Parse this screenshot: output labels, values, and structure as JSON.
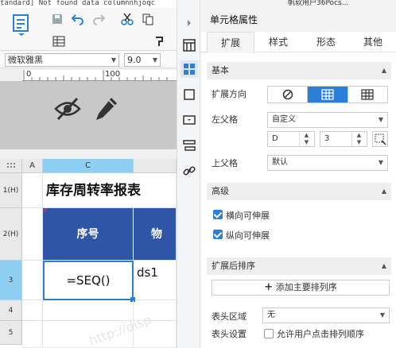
{
  "top_strip": {
    "text": "tandard] Not found data columnnhjoqc"
  },
  "toolbar": {
    "grid_icon": "table-grid-icon",
    "paint_icon": "format-painter-icon"
  },
  "font_row": {
    "font_family": "微软雅黑",
    "font_size": "9.0"
  },
  "ruler": {
    "mark_0": "0",
    "mark_100": "100"
  },
  "grid": {
    "col_a": "A",
    "col_c": "C",
    "rows": [
      "1(H)",
      "2(H)",
      "3",
      "4",
      "5"
    ],
    "title_text": "库存周转率报表",
    "header_cell": "序号",
    "header_cell_partial": "物",
    "formula_cell": "=SEQ()",
    "ds_cell": "ds1",
    "watermark": "http://disp"
  },
  "top_right": {
    "text": "帆软用户36Pocs..."
  },
  "panel": {
    "title": "单元格属性",
    "tabs": [
      "扩展",
      "样式",
      "形态",
      "其他"
    ],
    "section_basic": "基本",
    "expand_direction_label": "扩展方向",
    "left_parent_label": "左父格",
    "left_parent_value": "自定义",
    "left_parent_col": "D",
    "left_parent_row": "3",
    "up_parent_label": "上父格",
    "up_parent_value": "默认",
    "section_advanced": "高级",
    "horizontal_expandable": "横向可伸展",
    "vertical_expandable": "纵向可伸展",
    "section_sort": "扩展后排序",
    "add_sort_button": "添加主要排列序",
    "header_area_label": "表头区域",
    "header_area_value": "无",
    "header_settings_label": "表头设置",
    "allow_sort_label": "允许用户点击排列顺序"
  },
  "colors": {
    "accent": "#2b7fd8",
    "header_blue": "#2e55a6",
    "highlight_cell": "#8fd0f2"
  }
}
